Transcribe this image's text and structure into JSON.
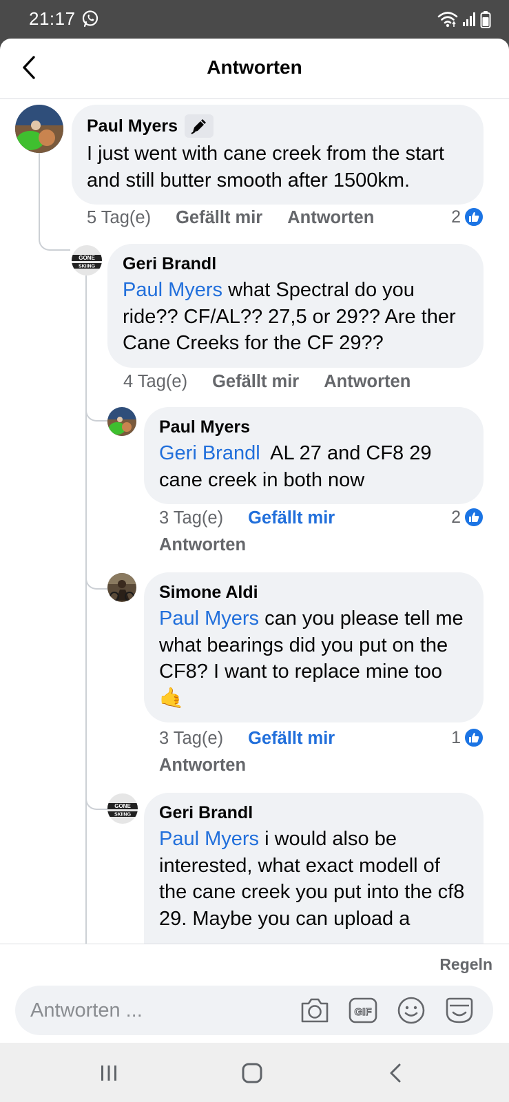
{
  "status_bar": {
    "time": "21:17",
    "icons": [
      "whatsapp-icon",
      "wifi-icon",
      "signal-icon",
      "battery-icon"
    ]
  },
  "header": {
    "title": "Antworten",
    "back_icon": "chevron-left-icon"
  },
  "comments": [
    {
      "author": "Paul Myers",
      "badge": "top-fan-pen-icon",
      "mention": "",
      "text": "I just went with cane creek from the start and still butter smooth after 1500km.",
      "time": "5 Tag(e)",
      "like_label": "Gefällt mir",
      "like_active": false,
      "reply_label": "Antworten",
      "reactions": "2"
    },
    {
      "author": "Geri Brandl",
      "mention": "Paul Myers",
      "text": " what Spectral do you ride?? CF/AL?? 27,5 or 29?? Are ther Cane Creeks for the CF 29??",
      "time": "4 Tag(e)",
      "like_label": "Gefällt mir",
      "like_active": false,
      "reply_label": "Antworten",
      "reactions": ""
    },
    {
      "author": "Paul Myers",
      "mention": "Geri Brandl",
      "text": "  AL 27 and CF8 29 cane creek in both now",
      "time": "3 Tag(e)",
      "like_label": "Gefällt mir",
      "like_active": true,
      "reply_label": "Antworten",
      "reactions": "2"
    },
    {
      "author": "Simone Aldi",
      "mention": "Paul Myers",
      "text": " can you please tell me what bearings did you put on the CF8? I want to replace mine too 🤙",
      "time": "3 Tag(e)",
      "like_label": "Gefällt mir",
      "like_active": true,
      "reply_label": "Antworten",
      "reactions": "1"
    },
    {
      "author": "Geri Brandl",
      "mention": "Paul Myers",
      "text": " i would also be interested, what exact modell of the cane creek you put into the cf8 29. Maybe you can upload a",
      "time": "",
      "like_label": "",
      "like_active": false,
      "reply_label": "",
      "reactions": ""
    }
  ],
  "footer": {
    "rules_link": "Regeln",
    "input_placeholder": "Antworten ...",
    "icons": [
      "camera-icon",
      "gif-icon",
      "emoji-icon",
      "sticker-icon"
    ]
  },
  "nav_bar": {
    "icons": [
      "recent-apps-icon",
      "home-icon",
      "back-icon"
    ]
  },
  "colors": {
    "mention": "#216fdb",
    "bubble": "#f0f2f5",
    "like_blue": "#1b74e4",
    "secondary_text": "#65676b",
    "status_bar": "#4a4a4a"
  }
}
